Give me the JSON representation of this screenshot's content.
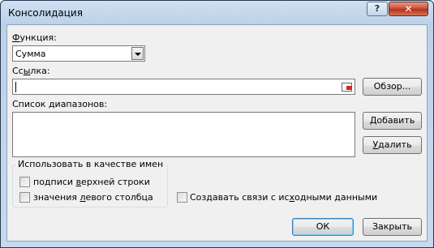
{
  "window": {
    "title": "Консолидация",
    "help_glyph": "?",
    "close_glyph": "✕"
  },
  "function": {
    "label_pre": "",
    "label_u": "Ф",
    "label_post": "ункция:",
    "value": "Сумма"
  },
  "reference": {
    "label_pre": "Сс",
    "label_u": "ы",
    "label_post": "лка:",
    "value": "",
    "browse_label": "Обзор..."
  },
  "ranges": {
    "label": "Список диапазонов:",
    "items": [],
    "add_pre": "",
    "add_u": "Д",
    "add_post": "обавить",
    "delete_pre": "",
    "delete_u": "У",
    "delete_post": "далить"
  },
  "use_labels": {
    "title": "Использовать в качестве имен",
    "top_row_pre": "подписи ",
    "top_row_u": "в",
    "top_row_post": "ерхней строки",
    "top_row_checked": false,
    "left_col_pre": "значения ",
    "left_col_u": "л",
    "left_col_post": "евого столбца",
    "left_col_checked": false
  },
  "links": {
    "label_pre": "Создавать связи с ис",
    "label_u": "х",
    "label_post": "одными данными",
    "checked": false
  },
  "footer": {
    "ok_label": "ОК",
    "close_label": "Закрыть"
  }
}
